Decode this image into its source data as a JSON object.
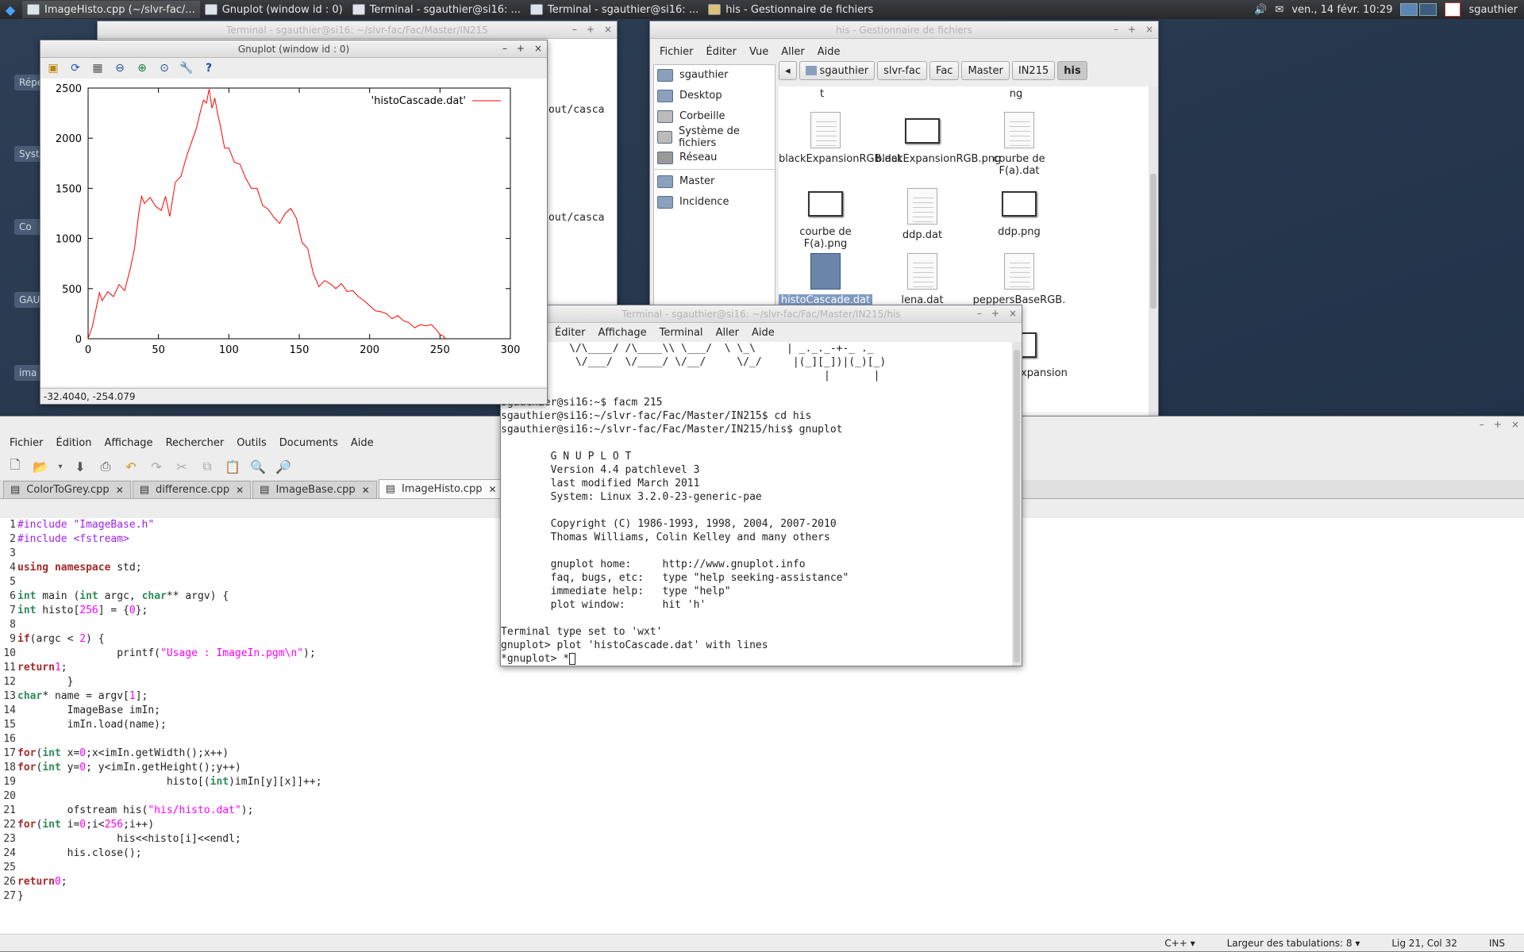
{
  "taskbar": {
    "tasks": [
      {
        "label": "ImageHisto.cpp (~/slvr-fac/..."
      },
      {
        "label": "Gnuplot (window id : 0)"
      },
      {
        "label": "Terminal - sgauthier@si16: ..."
      },
      {
        "label": "Terminal - sgauthier@si16: ..."
      },
      {
        "label": "his - Gestionnaire de fichiers"
      }
    ],
    "clock": "ven., 14 févr. 10:29",
    "user": "sgauthier"
  },
  "desktop": {
    "labels": [
      "Répe",
      "Syste",
      "Co",
      "GAU",
      "ima"
    ]
  },
  "bg_terminal": {
    "title": "Terminal - sgauthier@si16: ~/slvr-fac/Fac/Master/IN215",
    "lines": [
      "out/casca",
      "out/casca"
    ]
  },
  "gnuplot": {
    "title": "Gnuplot (window id : 0)",
    "status": "-32.4040, -254.079",
    "tools": [
      "folder-icon",
      "refresh-icon",
      "grid-icon",
      "zoom-out-icon",
      "zoom-in-icon",
      "zoom-fit-icon",
      "settings-icon",
      "help-icon"
    ]
  },
  "chart_data": {
    "type": "line",
    "title": "",
    "xlabel": "",
    "ylabel": "",
    "xlim": [
      0,
      300
    ],
    "ylim": [
      0,
      2500
    ],
    "xticks": [
      "0",
      "50",
      "100",
      "150",
      "200",
      "250",
      "300"
    ],
    "yticks": [
      "0",
      "500",
      "1000",
      "1500",
      "2000",
      "2500"
    ],
    "legend_position": "top-right",
    "color": "#ff0000",
    "series": [
      {
        "name": "'histoCascade.dat'",
        "x": [
          0,
          3,
          6,
          8,
          10,
          14,
          18,
          22,
          26,
          30,
          33,
          36,
          38,
          40,
          44,
          48,
          52,
          55,
          58,
          62,
          66,
          70,
          74,
          77,
          80,
          82,
          84,
          86,
          88,
          90,
          92,
          94,
          97,
          100,
          104,
          108,
          112,
          116,
          120,
          124,
          128,
          132,
          136,
          140,
          144,
          148,
          152,
          156,
          160,
          164,
          168,
          172,
          176,
          180,
          184,
          188,
          192,
          196,
          200,
          204,
          208,
          212,
          216,
          220,
          224,
          228,
          232,
          236,
          240,
          244,
          248,
          250,
          252,
          254
        ],
        "y": [
          0,
          120,
          320,
          460,
          380,
          470,
          420,
          540,
          480,
          700,
          900,
          1250,
          1420,
          1350,
          1410,
          1320,
          1280,
          1420,
          1220,
          1560,
          1620,
          1820,
          1980,
          2100,
          2280,
          2380,
          2350,
          2490,
          2300,
          2400,
          2250,
          2120,
          1900,
          1900,
          1760,
          1740,
          1600,
          1500,
          1500,
          1330,
          1290,
          1210,
          1150,
          1250,
          1300,
          1200,
          960,
          900,
          650,
          520,
          580,
          550,
          500,
          550,
          470,
          480,
          420,
          380,
          330,
          280,
          270,
          250,
          200,
          230,
          180,
          160,
          110,
          140,
          130,
          140,
          80,
          40,
          30,
          0
        ]
      }
    ]
  },
  "file_manager": {
    "title": "his - Gestionnaire de fichiers",
    "menu": [
      "Fichier",
      "Éditer",
      "Vue",
      "Aller",
      "Aide"
    ],
    "places": [
      {
        "label": "sgauthier",
        "icon": "home-icon"
      },
      {
        "label": "Desktop",
        "icon": "desktop-icon"
      },
      {
        "label": "Corbeille",
        "icon": "trash-icon"
      },
      {
        "label": "Système de fichiers",
        "icon": "drive-icon"
      },
      {
        "label": "Réseau",
        "icon": "network-icon"
      },
      {
        "label": "Master",
        "icon": "folder-icon"
      },
      {
        "label": "Incidence",
        "icon": "folder-icon"
      }
    ],
    "breadcrumbs": [
      "sgauthier",
      "slvr-fac",
      "Fac",
      "Master",
      "IN215",
      "his"
    ],
    "files": [
      {
        "label": "t",
        "kind": "partial"
      },
      {
        "label": "ng",
        "kind": "partial"
      },
      {
        "label": "blackExpansionRGB.dat",
        "kind": "doc"
      },
      {
        "label": "blackExpansionRGB.png",
        "kind": "img"
      },
      {
        "label": "courbe de F(a).dat",
        "kind": "doc"
      },
      {
        "label": "courbe de F(a).png",
        "kind": "img"
      },
      {
        "label": "ddp.dat",
        "kind": "doc"
      },
      {
        "label": "ddp.png",
        "kind": "img"
      },
      {
        "label": "histoCascade.dat",
        "kind": "doc"
      },
      {
        "label": "lena.dat",
        "kind": "doc"
      },
      {
        "label": "peppersBaseRGB.",
        "kind": "doc"
      },
      {
        "label": "peppersExpansion",
        "kind": "img"
      }
    ]
  },
  "terminal": {
    "title": "Terminal - sgauthier@si16: ~/slvr-fac/Fac/Master/IN215/his",
    "menu": [
      "Éditer",
      "Affichage",
      "Terminal",
      "Aller",
      "Aide"
    ],
    "lines": [
      "           \\/\\____/ /\\____\\\\ \\___/  \\ \\_\\     | _._._-+-_ ._",
      "            \\/___/  \\/____/ \\/__/     \\/_/     |(_][_])|(_)[_)",
      "                                                    |       |",
      "",
      "sgauthier@si16:~$ facm 215",
      "sgauthier@si16:~/slvr-fac/Fac/Master/IN215$ cd his",
      "sgauthier@si16:~/slvr-fac/Fac/Master/IN215/his$ gnuplot",
      "",
      "\tG N U P L O T",
      "\tVersion 4.4 patchlevel 3",
      "\tlast modified March 2011",
      "\tSystem: Linux 3.2.0-23-generic-pae",
      "",
      "\tCopyright (C) 1986-1993, 1998, 2004, 2007-2010",
      "\tThomas Williams, Colin Kelley and many others",
      "",
      "\tgnuplot home:     http://www.gnuplot.info",
      "\tfaq, bugs, etc:   type \"help seeking-assistance\"",
      "\timmediate help:   type \"help\"",
      "\tplot window:      hit 'h'",
      "",
      "Terminal type set to 'wxt'",
      "gnuplot> plot 'histoCascade.dat' with lines"
    ],
    "prompt": "*gnuplot> *"
  },
  "gedit": {
    "menu": [
      "Fichier",
      "Édition",
      "Affichage",
      "Rechercher",
      "Outils",
      "Documents",
      "Aide"
    ],
    "tabs": [
      {
        "label": "ColorToGrey.cpp"
      },
      {
        "label": "difference.cpp"
      },
      {
        "label": "ImageBase.cpp"
      },
      {
        "label": "ImageHisto.cpp"
      }
    ],
    "status": {
      "language": "C++",
      "tab_width": "Largeur des tabulations:  8",
      "position": "Lig 21, Col 32",
      "mode": "INS"
    }
  }
}
